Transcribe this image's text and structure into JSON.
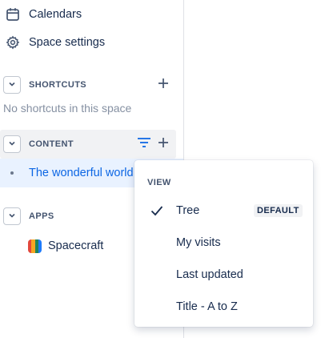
{
  "sidebar": {
    "nav": [
      {
        "label": "Calendars",
        "icon": "calendar-icon"
      },
      {
        "label": "Space settings",
        "icon": "gear-icon"
      }
    ],
    "shortcuts": {
      "title": "SHORTCUTS",
      "empty_text": "No shortcuts in this space"
    },
    "content": {
      "title": "CONTENT",
      "items": [
        {
          "label": "The wonderful world"
        }
      ]
    },
    "apps": {
      "title": "APPS",
      "items": [
        {
          "label": "Spacecraft",
          "icon": "spacecraft-logo-icon"
        }
      ]
    }
  },
  "view_menu": {
    "heading": "VIEW",
    "items": [
      {
        "label": "Tree",
        "selected": true,
        "badge": "DEFAULT"
      },
      {
        "label": "My visits",
        "selected": false
      },
      {
        "label": "Last updated",
        "selected": false
      },
      {
        "label": "Title - A to Z",
        "selected": false
      }
    ]
  },
  "colors": {
    "accent": "#0c66e4",
    "active_item_bg": "#e9f2ff",
    "header_active_bg": "#f1f2f4",
    "text": "#172b4d",
    "muted": "#8590a2"
  }
}
